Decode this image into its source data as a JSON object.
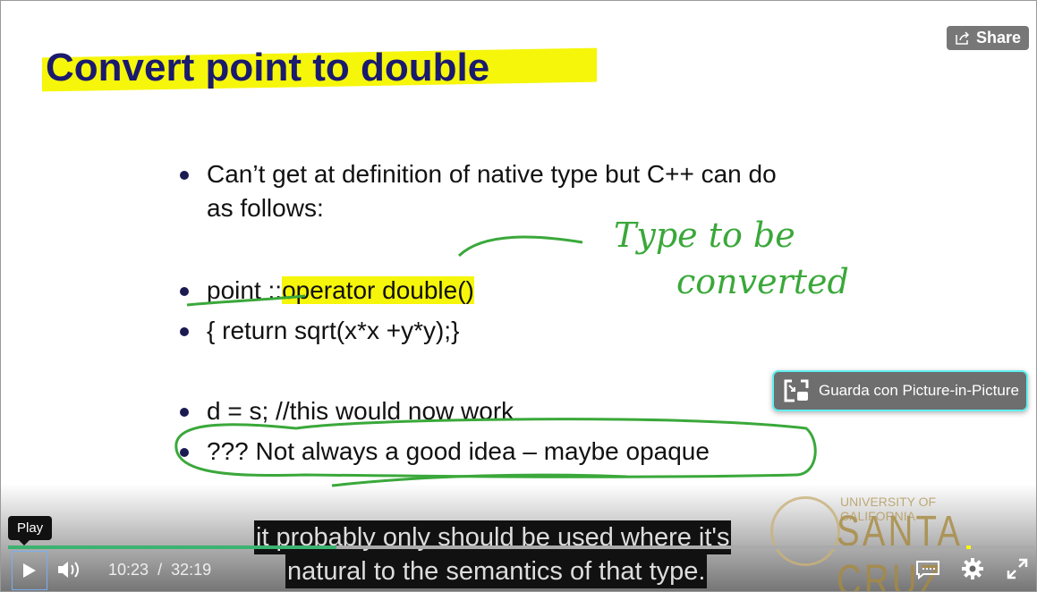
{
  "slide": {
    "title": "Convert point to double",
    "bullets": [
      {
        "line1": "Can’t get at definition of native type but C++  can  do",
        "line2": "as follows:"
      },
      {
        "prefix": "point ::",
        "highlight": "operator double()"
      },
      {
        "text": "{   return  sqrt(x*x +y*y);}"
      },
      {
        "text": "d = s; //this would now work"
      },
      {
        "text": "???  Not always a good idea – maybe opaque"
      }
    ],
    "handwriting": {
      "line1": "Type to be",
      "line2": "converted"
    },
    "logo": {
      "top": "UNIVERSITY OF CALIFORNIA",
      "main": "SANTA CRUZ"
    }
  },
  "overlay": {
    "share_label": "Share",
    "pip_label": "Guarda con Picture-in-Picture"
  },
  "captions": {
    "line1": "it probably only should be used where it's",
    "line2": "natural to the semantics of that type."
  },
  "player": {
    "tooltip": "Play",
    "current_time": "10:23",
    "separator": "/",
    "duration": "32:19",
    "progress_fraction": 0.32,
    "chapter_marker_fraction": 0.934,
    "colors": {
      "progress": "#3cb371",
      "marker": "#ffff00",
      "pip_border": "#5ff0f0",
      "highlight": "#f6f60a",
      "ink": "#3aa83a"
    }
  }
}
